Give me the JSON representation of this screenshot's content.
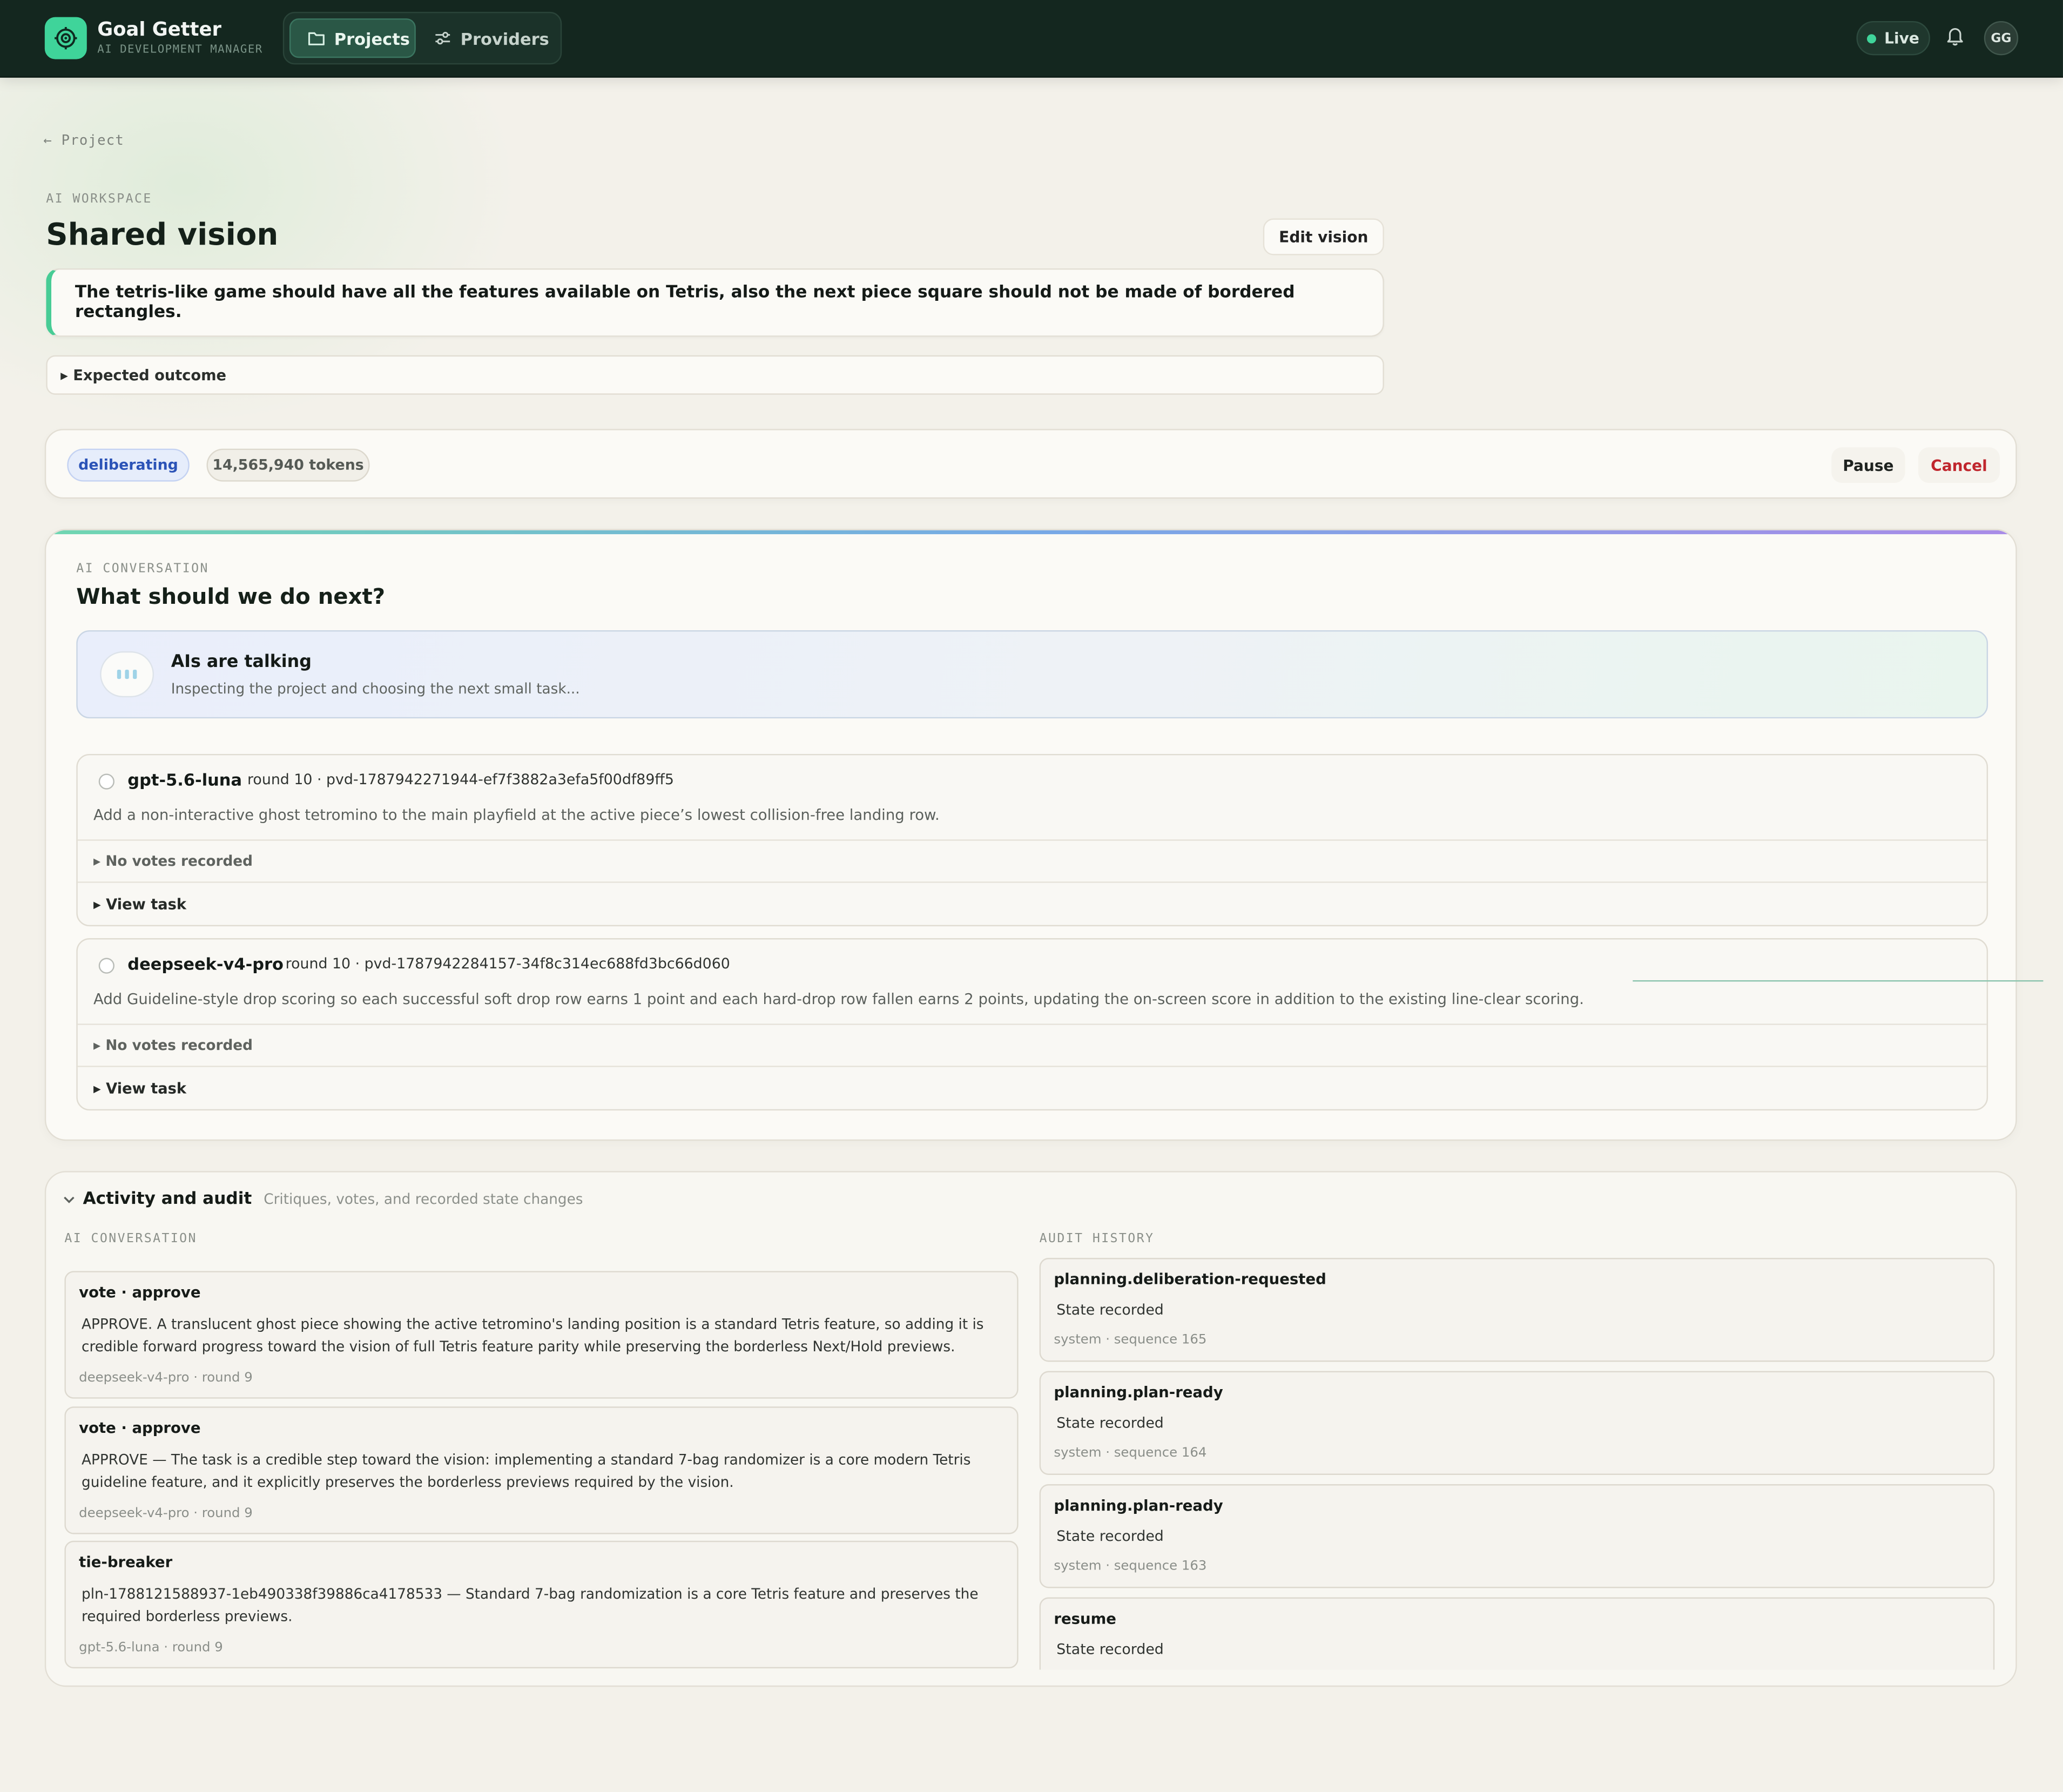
{
  "brand": {
    "name": "Goal Getter",
    "tagline": "AI DEVELOPMENT MANAGER"
  },
  "nav": {
    "projects": "Projects",
    "providers": "Providers"
  },
  "header": {
    "live": "Live",
    "avatar": "GG"
  },
  "breadcrumb": {
    "back": "← Project"
  },
  "vision": {
    "section_label": "AI WORKSPACE",
    "title": "Shared vision",
    "edit_label": "Edit vision",
    "text": "The tetris-like game should have all the features available on Tetris, also the next piece square should not be made of bordered rectangles.",
    "expected_outcome": "▸ Expected outcome"
  },
  "status": {
    "state": "deliberating",
    "tokens": "14,565,940 tokens",
    "pause": "Pause",
    "cancel": "Cancel"
  },
  "conversation": {
    "label": "AI CONVERSATION",
    "title": "What should we do next?",
    "talking_title": "AIs are talking",
    "talking_sub": "Inspecting the project and choosing the next small task...",
    "proposals": [
      {
        "model": "gpt-5.6-luna",
        "meta": "round 10 · pvd-1787942271944-ef7f3882a3efa5f00df89ff5",
        "description": "Add a non-interactive ghost tetromino to the main playfield at the active piece’s lowest collision-free landing row.",
        "votes": "▸ No votes recorded",
        "view": "▸ View task"
      },
      {
        "model": "deepseek-v4-pro",
        "meta": "round 10 · pvd-1787942284157-34f8c314ec688fd3bc66d060",
        "description": "Add Guideline-style drop scoring so each successful soft drop row earns 1 point and each hard-drop row fallen earns 2 points, updating the on-screen score in addition to the existing line-clear scoring.",
        "votes": "▸ No votes recorded",
        "view": "▸ View task"
      }
    ]
  },
  "activity": {
    "title": "Activity and audit",
    "subtitle": "Critiques, votes, and recorded state changes",
    "left_label": "AI CONVERSATION",
    "right_label": "AUDIT HISTORY",
    "conversation": [
      {
        "title": "vote · approve",
        "body": "APPROVE. A translucent ghost piece showing the active tetromino's landing position is a standard Tetris feature, so adding it is credible forward progress toward the vision of full Tetris feature parity while preserving the borderless Next/Hold previews.",
        "meta": "deepseek-v4-pro · round 9"
      },
      {
        "title": "vote · approve",
        "body": "APPROVE — The task is a credible step toward the vision: implementing a standard 7-bag randomizer is a core modern Tetris guideline feature, and it explicitly preserves the borderless previews required by the vision.",
        "meta": "deepseek-v4-pro · round 9"
      },
      {
        "title": "tie-breaker",
        "body": "pln-1788121588937-1eb490338f39886ca4178533 — Standard 7-bag randomization is a core Tetris feature and preserves the required borderless previews.",
        "meta": "gpt-5.6-luna · round 9"
      }
    ],
    "audit": [
      {
        "event": "planning.deliberation-requested",
        "state": "State recorded",
        "meta": "system · sequence 165"
      },
      {
        "event": "planning.plan-ready",
        "state": "State recorded",
        "meta": "system · sequence 164"
      },
      {
        "event": "planning.plan-ready",
        "state": "State recorded",
        "meta": "system · sequence 163"
      },
      {
        "event": "resume",
        "state": "State recorded",
        "meta": ""
      }
    ]
  },
  "icons": {
    "logo": "target-icon",
    "projects": "folder-icon",
    "providers": "sliders-icon",
    "notifications": "bell-icon",
    "collapse": "chevron-down-icon"
  },
  "colors": {
    "topbar": "#14271f",
    "accent": "#3fd49a",
    "deliberating": "#2b53b7",
    "cancel": "#c0262d",
    "background": "#f3f1ea"
  }
}
